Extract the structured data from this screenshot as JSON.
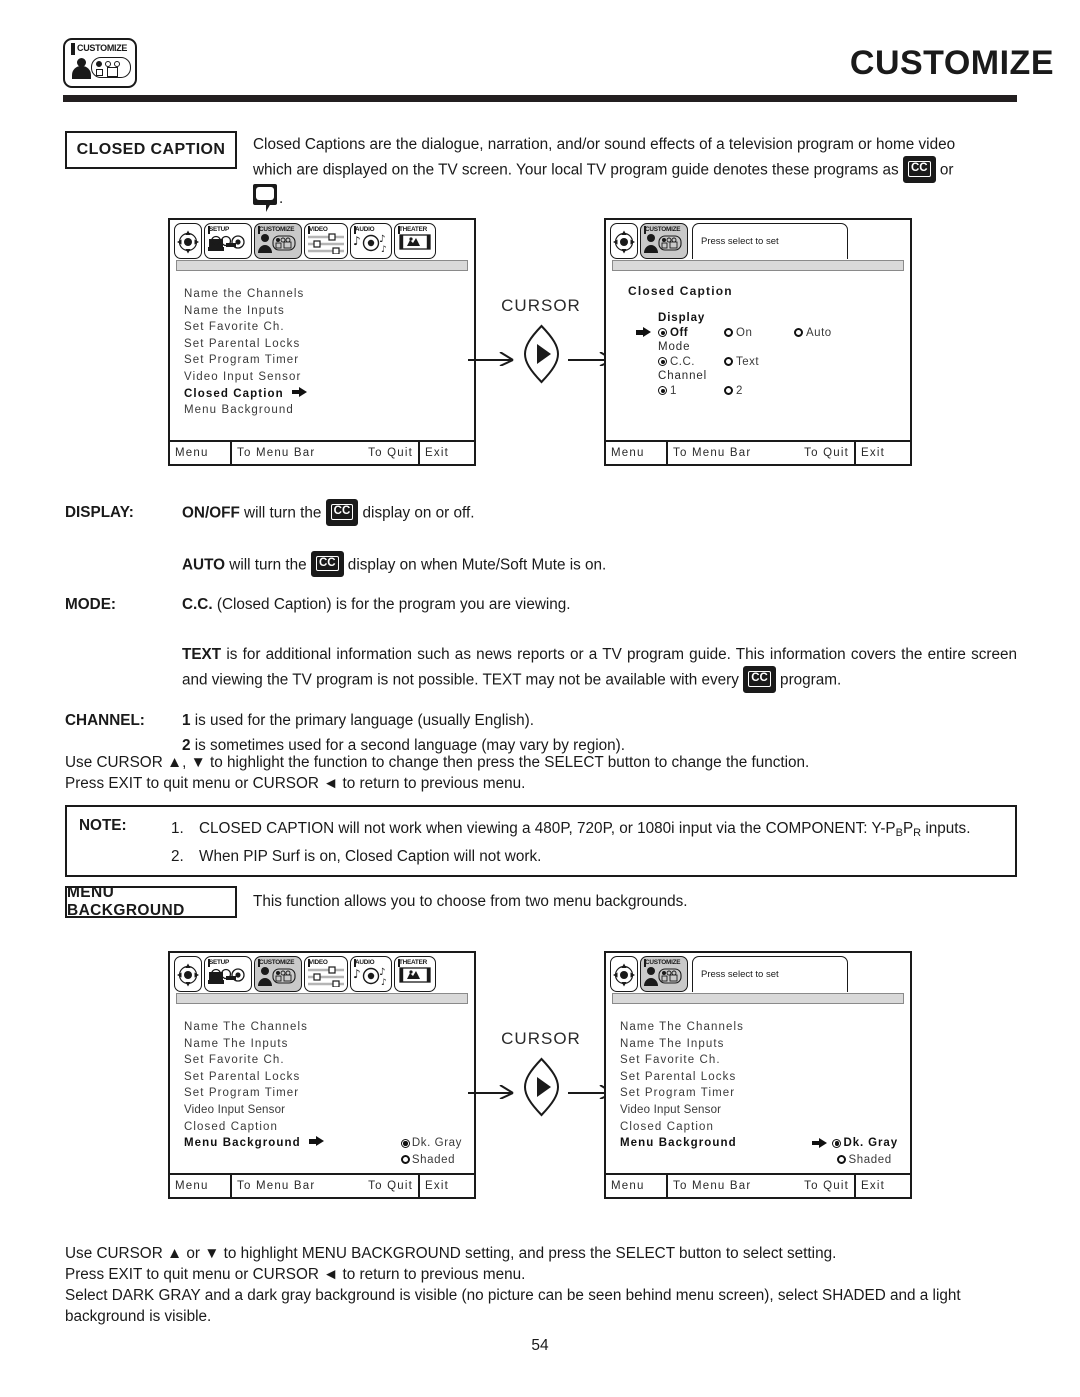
{
  "header": {
    "icon_label": "CUSTOMIZE",
    "title": "CUSTOMIZE"
  },
  "closed_caption": {
    "badge": "CLOSED CAPTION",
    "intro_line1": "Closed Captions are the dialogue, narration, and/or sound effects of a television program or home video",
    "intro_line2a": "which are displayed on the TV screen.  Your local TV program guide denotes these programs as",
    "cc_chip": "CC",
    "intro_or": "or",
    "intro_period": "."
  },
  "menu_bar": {
    "tabs": [
      {
        "label": "",
        "name": "cursor-pad"
      },
      {
        "label": "SETUP",
        "name": "setup"
      },
      {
        "label": "CUSTOMIZE",
        "name": "customize"
      },
      {
        "label": "VIDEO",
        "name": "video"
      },
      {
        "label": "AUDIO",
        "name": "audio"
      },
      {
        "label": "THEATER",
        "name": "theater"
      }
    ],
    "selected": "CUSTOMIZE"
  },
  "tv_footer": {
    "menu": "Menu",
    "to_menu_bar": "To Menu Bar",
    "to_quit": "To Quit",
    "exit": "Exit"
  },
  "tip": {
    "text": "Press select to set"
  },
  "screen1": {
    "items": [
      "Name the Channels",
      "Name the Inputs",
      "Set Favorite Ch.",
      "Set Parental Locks",
      "Set Program Timer",
      "Video Input Sensor",
      "Closed Caption",
      "Menu Background"
    ],
    "highlighted": "Closed Caption"
  },
  "screen2": {
    "title": "Closed Caption",
    "groups": [
      {
        "label": "Display",
        "bold_label": true,
        "pointer": true,
        "options": [
          {
            "text": "Off",
            "selected": true,
            "bold": true
          },
          {
            "text": "On",
            "selected": false,
            "bold": false
          },
          {
            "text": "Auto",
            "selected": false,
            "bold": false
          }
        ]
      },
      {
        "label": "Mode",
        "bold_label": false,
        "pointer": false,
        "options": [
          {
            "text": "C.C.",
            "selected": true,
            "bold": false
          },
          {
            "text": "Text",
            "selected": false,
            "bold": false
          }
        ]
      },
      {
        "label": "Channel",
        "bold_label": false,
        "pointer": false,
        "options": [
          {
            "text": "1",
            "selected": true,
            "bold": false
          },
          {
            "text": "2",
            "selected": false,
            "bold": false
          }
        ]
      }
    ]
  },
  "screen3": {
    "items": [
      "Name The Channels",
      "Name The Inputs",
      "Set Favorite Ch.",
      "Set Parental Locks",
      "Set Program Timer",
      "Video Input Sensor",
      "Closed Caption",
      "Menu Background"
    ],
    "highlighted": "Menu Background",
    "bg_options": [
      {
        "text": "Dk. Gray",
        "selected": true,
        "bold": false
      },
      {
        "text": "Shaded",
        "selected": false,
        "bold": false
      }
    ]
  },
  "screen4": {
    "items": [
      "Name The Channels",
      "Name The Inputs",
      "Set Favorite Ch.",
      "Set Parental Locks",
      "Set Program Timer",
      "Video Input Sensor",
      "Closed Caption",
      "Menu Background"
    ],
    "highlighted": "Menu Background",
    "bg_options": [
      {
        "text": "Dk. Gray",
        "selected": true,
        "bold": true
      },
      {
        "text": "Shaded",
        "selected": false,
        "bold": false
      }
    ]
  },
  "cursor_flow": {
    "label": "CURSOR"
  },
  "definitions": [
    {
      "term": "DISPLAY:",
      "lines": [
        {
          "bold": "ON/OFF",
          "before": "",
          "mid": " will turn the ",
          "chip": "CC",
          "after": " display on or off."
        },
        {
          "bold": "AUTO",
          "before": "",
          "mid": " will turn the ",
          "chip": "CC",
          "after": " display on when Mute/Soft Mute is on."
        }
      ]
    },
    {
      "term": "MODE:",
      "lines": [
        {
          "bold": "C.C.",
          "mid": " (Closed Caption) is for the program you are viewing.",
          "chip": null,
          "after": ""
        },
        {
          "bold": "TEXT",
          "mid": " is for additional information such as news reports or a TV program guide.  This information covers the entire screen and viewing the TV program is not possible.  TEXT may not be available with every ",
          "chip": "CC",
          "after": " program."
        }
      ]
    },
    {
      "term": "CHANNEL:",
      "lines": [
        {
          "bold": "1",
          "mid": " is used for the primary language (usually English).",
          "chip": null,
          "after": ""
        },
        {
          "bold": "2",
          "mid": " is sometimes used for a second language (may vary by region).",
          "chip": null,
          "after": ""
        }
      ]
    }
  ],
  "instructions1": {
    "line1": "Use CURSOR ▲, ▼ to highlight the function to change then press the SELECT button to change the function.",
    "line2": "Press EXIT to quit menu or CURSOR ◄ to return to previous menu."
  },
  "note": {
    "label": "NOTE:",
    "items": [
      {
        "num": "1.",
        "text_a": "CLOSED CAPTION will not work when viewing a 480P, 720P, or 1080i input via the COMPONENT: Y-P",
        "sub_b": "B",
        "text_b": "P",
        "sub_r": "R",
        "text_c": " inputs."
      },
      {
        "num": "2.",
        "text_a": "When PIP Surf is on, Closed Caption will not work.",
        "sub_b": "",
        "text_b": "",
        "sub_r": "",
        "text_c": ""
      }
    ]
  },
  "menu_background": {
    "badge": "MENU BACKGROUND",
    "intro": "This function allows you to choose from two menu backgrounds."
  },
  "instructions2": {
    "line1": "Use CURSOR ▲ or ▼ to highlight MENU BACKGROUND setting, and press the SELECT button to select setting.",
    "line2": "Press EXIT to quit menu or CURSOR ◄ to return to previous menu.",
    "line3": "Select DARK GRAY and a dark gray background is visible (no picture can be seen behind menu screen), select SHADED and a light background is visible."
  },
  "page_number": "54",
  "colors": {
    "ink": "#1a1a1a",
    "rule": "#231f20",
    "tab_selected": "#c9c9c9",
    "strip": "#d9d9d9"
  }
}
